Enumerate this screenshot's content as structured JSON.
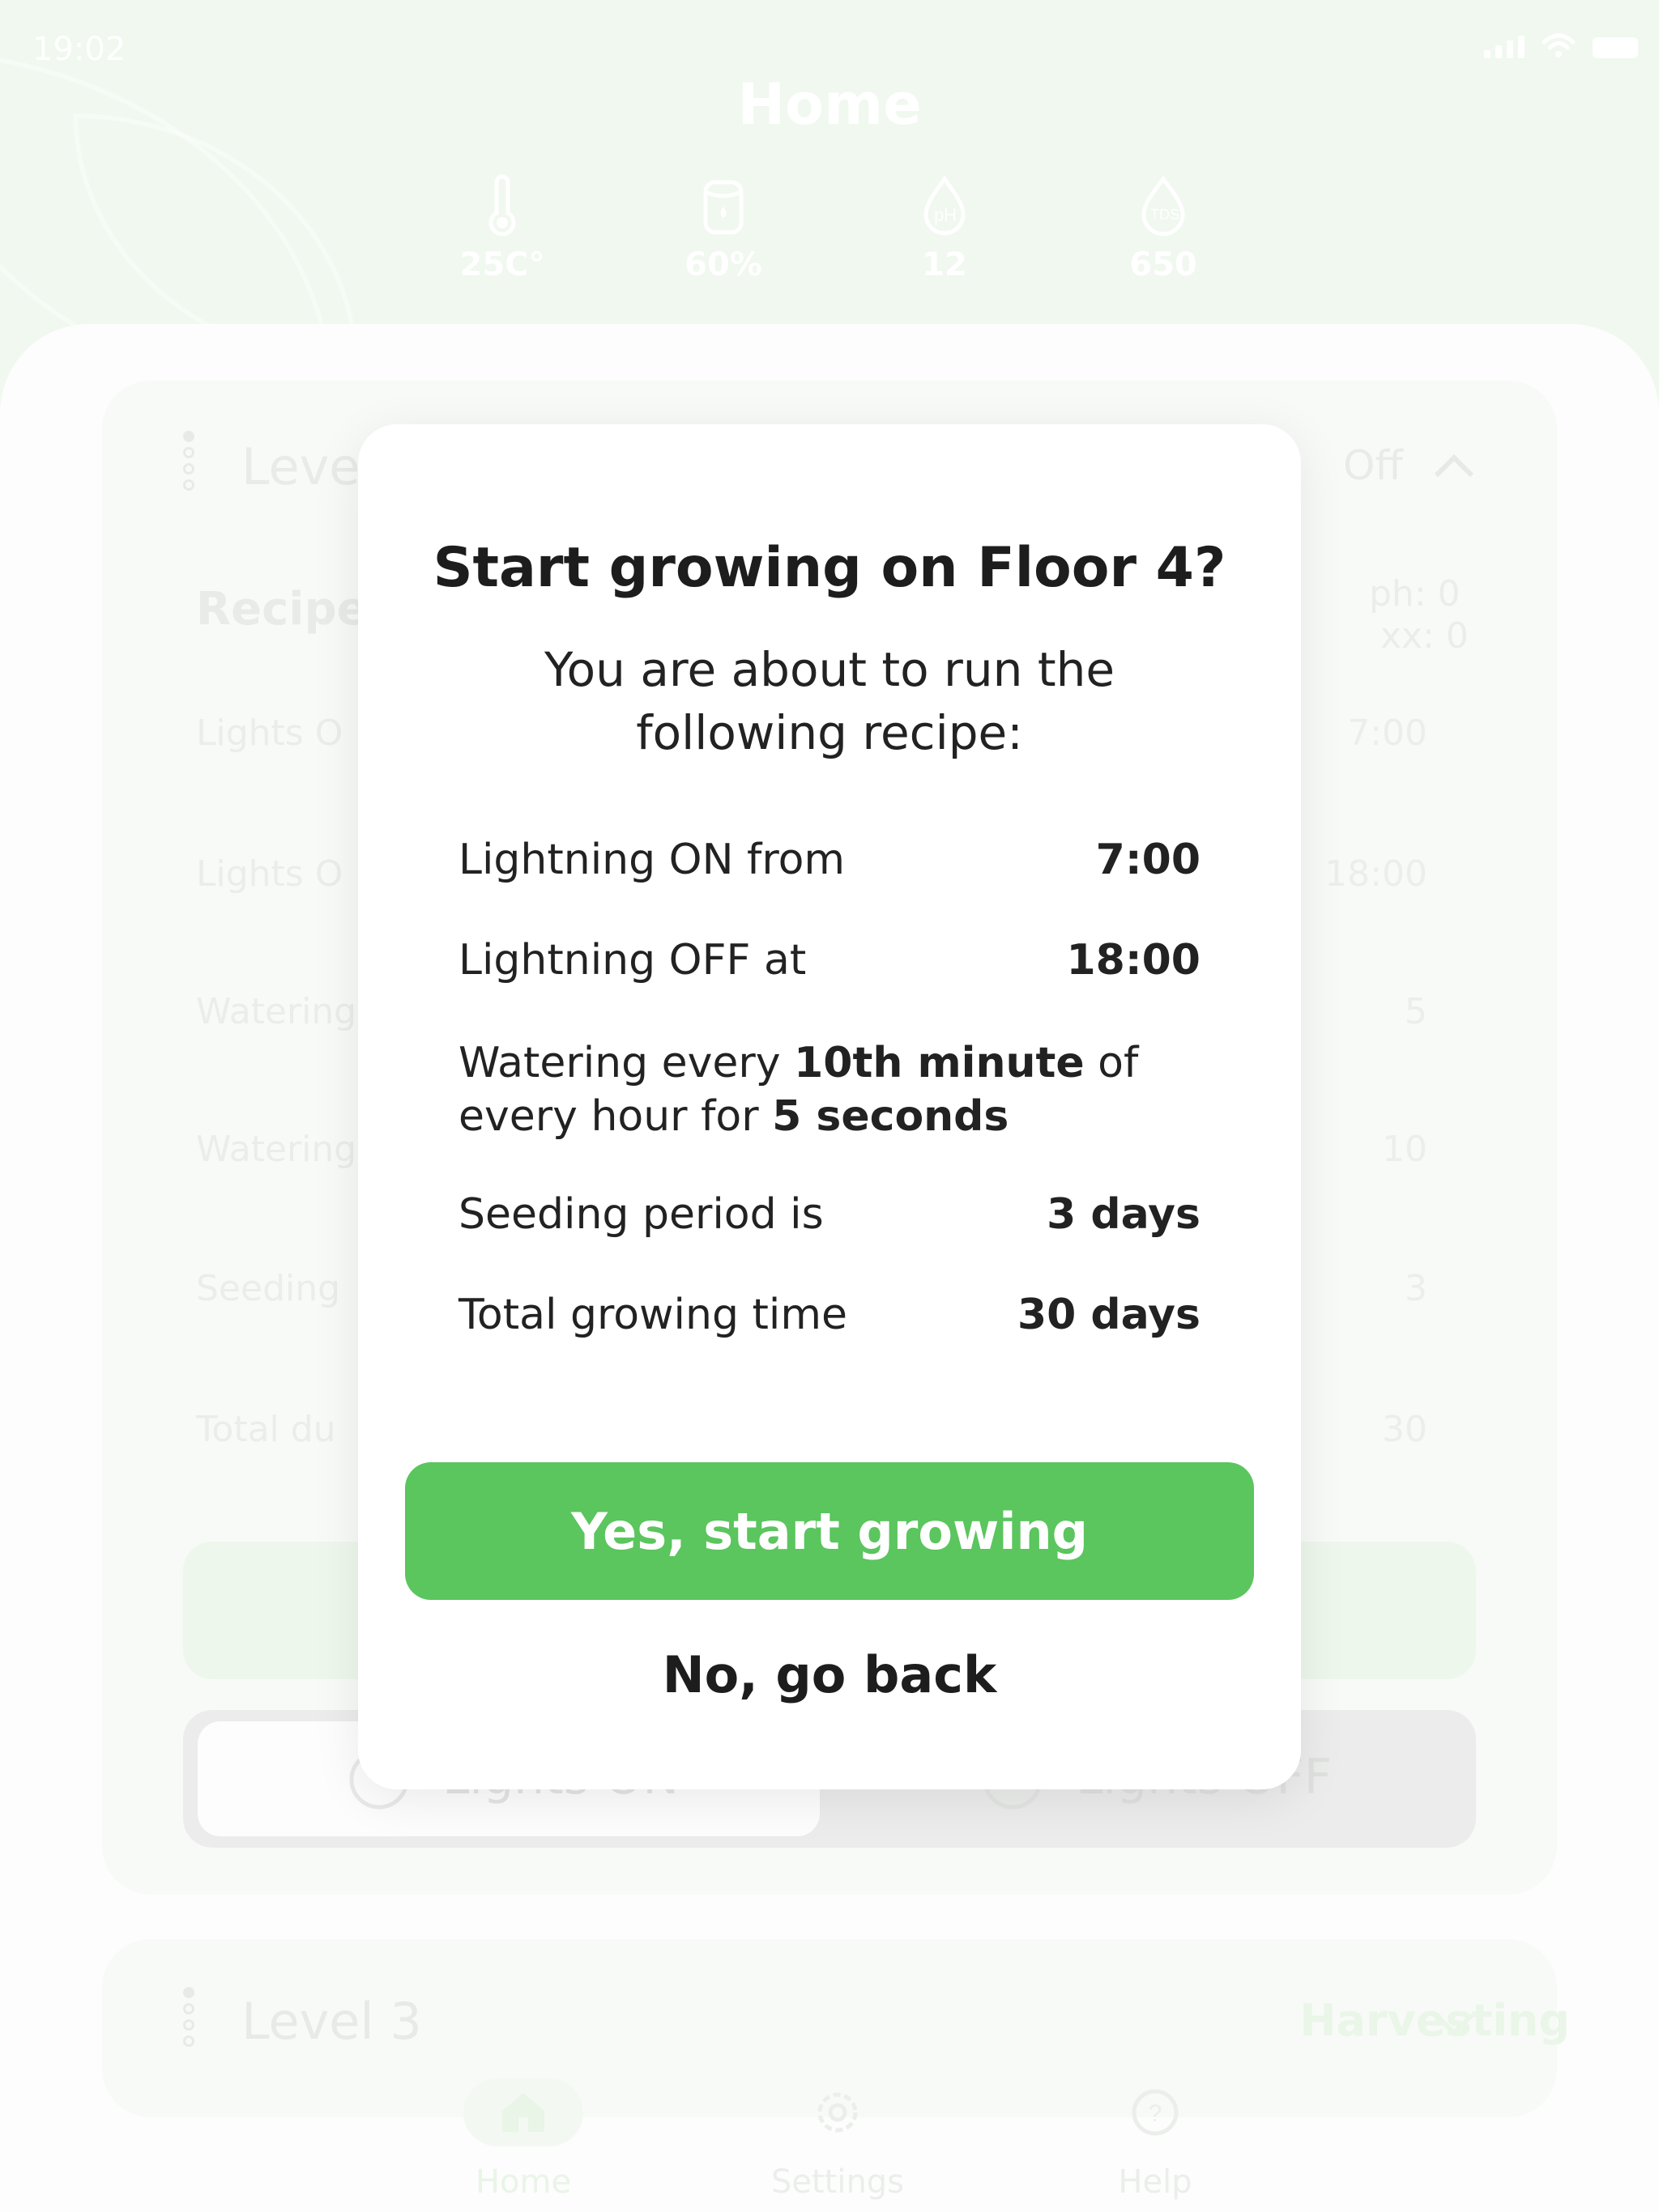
{
  "status_bar": {
    "time": "19:02"
  },
  "header": {
    "title": "Home"
  },
  "stats": [
    {
      "icon": "thermometer-icon",
      "value": "25C°"
    },
    {
      "icon": "tank-icon",
      "value": "60%"
    },
    {
      "icon": "ph-drop-icon",
      "value": "12",
      "icon_text": "pH"
    },
    {
      "icon": "tds-drop-icon",
      "value": "650",
      "icon_text": "TDS"
    }
  ],
  "level_card": {
    "title": "Leve",
    "status": "Off",
    "recipe_label": "Recipe",
    "ph_text": "ph: 0",
    "xx_text": "xx: 0",
    "rows": [
      {
        "label": "Lights O",
        "value": "7:00"
      },
      {
        "label": "Lights O",
        "value": "18:00"
      },
      {
        "label": "Watering",
        "value": "5"
      },
      {
        "label": "Watering",
        "value": "10"
      },
      {
        "label": "Seeding",
        "value": "3"
      },
      {
        "label": "Total du",
        "value": "30"
      }
    ],
    "lights_on_label": "Lights ON",
    "lights_off_label": "Lights OFF"
  },
  "level3_card": {
    "title": "Level 3",
    "status": "Harvesting"
  },
  "tabbar": [
    {
      "label": "Home",
      "icon": "home-icon"
    },
    {
      "label": "Settings",
      "icon": "gear-icon"
    },
    {
      "label": "Help",
      "icon": "help-icon"
    }
  ],
  "modal": {
    "title": "Start growing on Floor 4?",
    "subtitle_line1": "You are about to run the",
    "subtitle_line2": "following recipe:",
    "light_on_label": "Lightning ON from",
    "light_on_value": "7:00",
    "light_off_label": "Lightning OFF at",
    "light_off_value": "18:00",
    "water_prefix": "Watering every ",
    "water_minute": "10th minute",
    "water_mid": " of every hour for ",
    "water_seconds": "5 seconds",
    "seeding_label": "Seeding period is",
    "seeding_value": "3 days",
    "total_label": "Total growing time",
    "total_value": "30 days",
    "confirm_label": "Yes, start growing",
    "cancel_label": "No, go back"
  },
  "colors": {
    "header_bg": "#e1f1df",
    "primary_green": "#5bc55e",
    "modal_bg": "#ffffff"
  }
}
